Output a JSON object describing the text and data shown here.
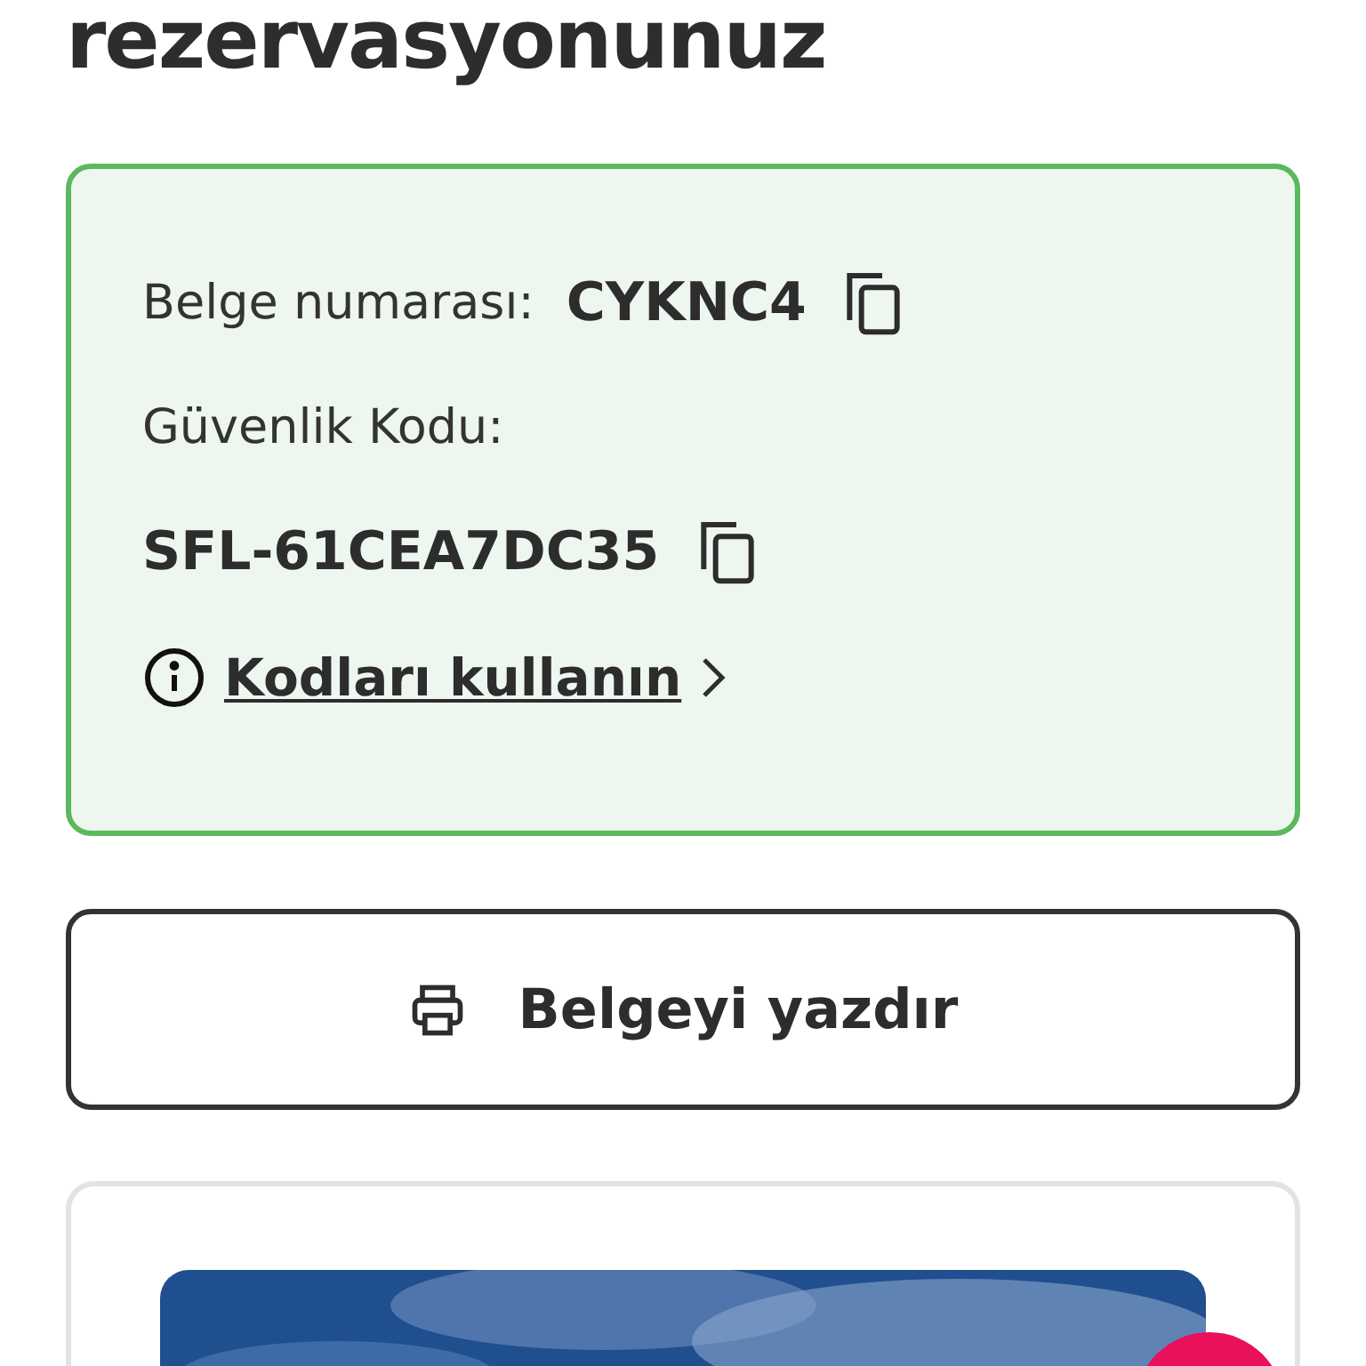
{
  "heading": "rezervasyonunuz",
  "codes_card": {
    "document_label": "Belge numarası:",
    "document_number": "CYKNC4",
    "security_label": "Güvenlik Kodu:",
    "security_code": "SFL-61CEA7DC35",
    "help_link": "Kodları kullanın"
  },
  "print_button": {
    "label": "Belgeyi yazdır"
  }
}
